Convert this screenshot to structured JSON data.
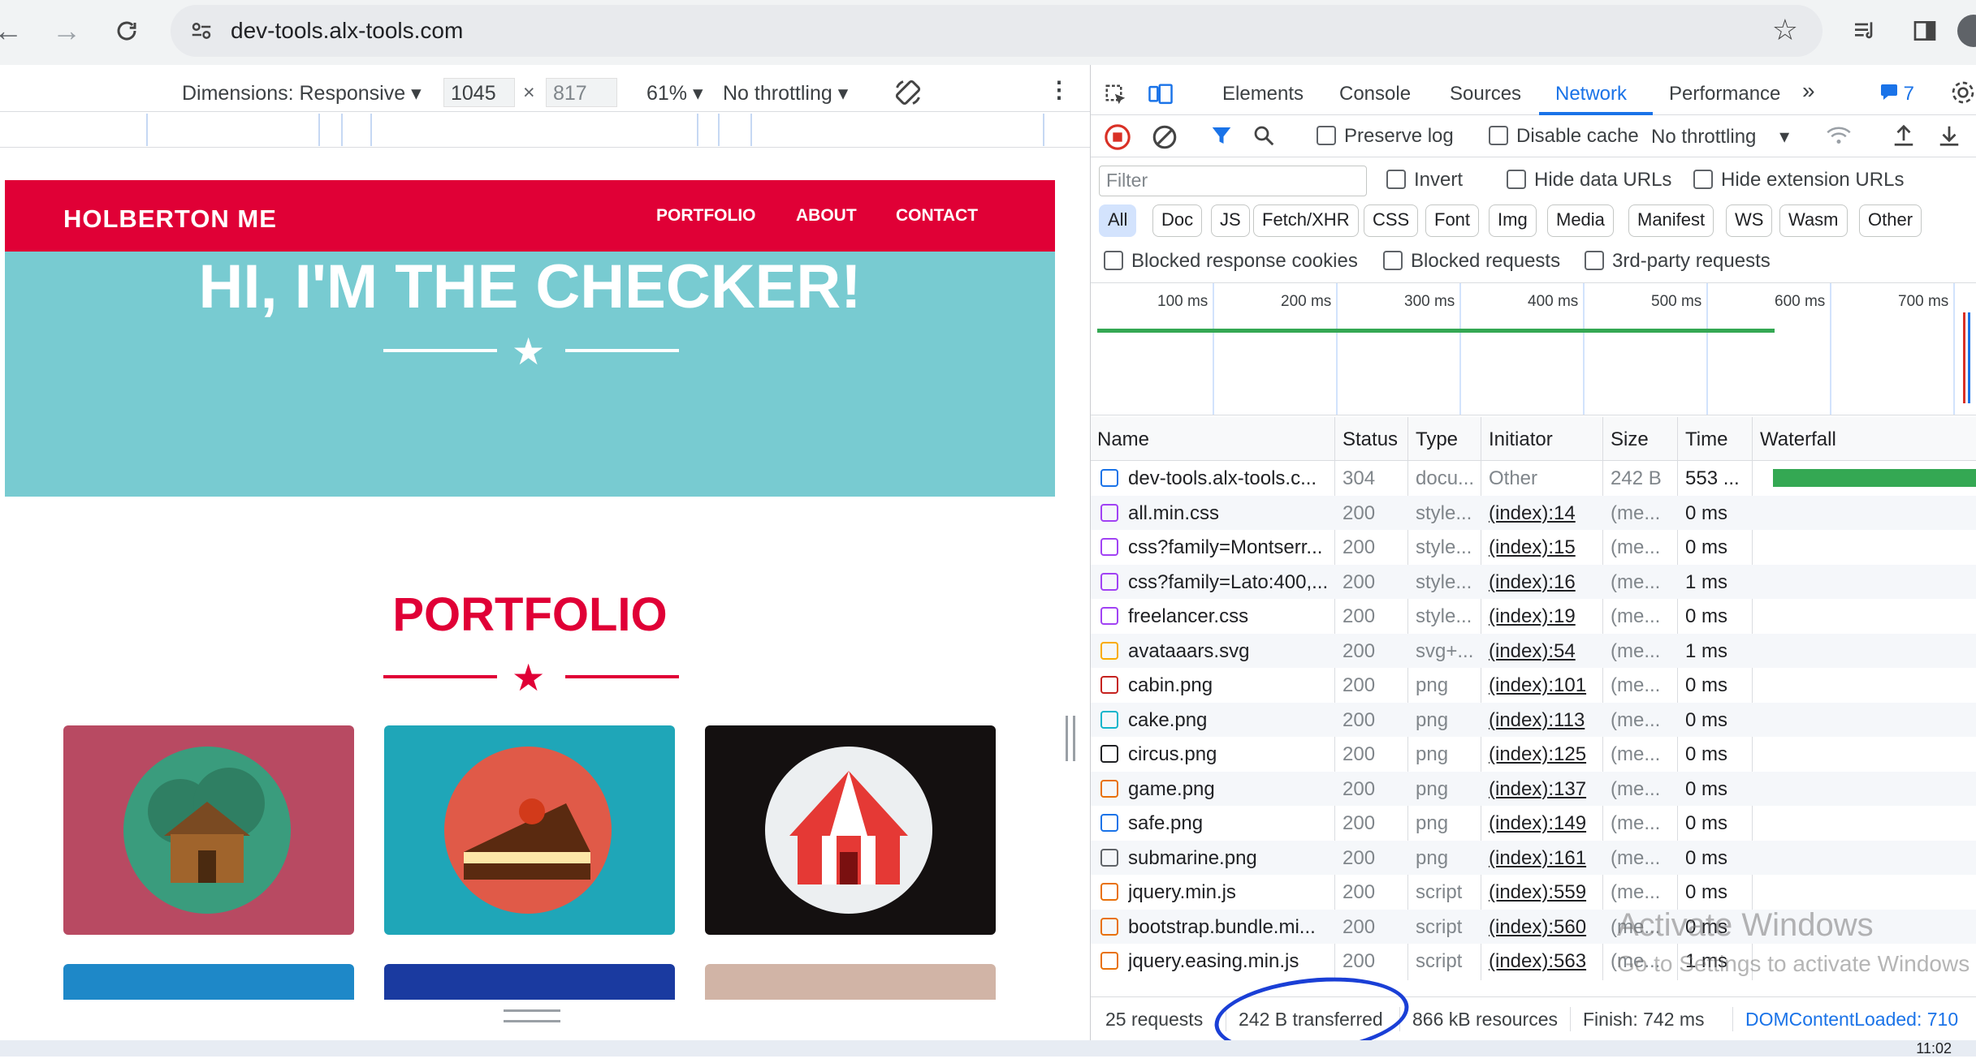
{
  "browser": {
    "url": "dev-tools.alx-tools.com"
  },
  "device_toolbar": {
    "dimensions_label": "Dimensions: Responsive",
    "width": "1045",
    "x_symbol": "×",
    "height": "817",
    "zoom": "61%",
    "throttling": "No throttling"
  },
  "page": {
    "brand": "HOLBERTON ME",
    "nav": [
      "PORTFOLIO",
      "ABOUT",
      "CONTACT"
    ],
    "hero_title": "HI, I'M THE CHECKER!",
    "portfolio_title": "PORTFOLIO",
    "colors": {
      "brand_red": "#e00036",
      "hero_teal": "#78cbd1"
    }
  },
  "devtools": {
    "tabs": [
      "Elements",
      "Console",
      "Sources",
      "Network",
      "Performance"
    ],
    "active_tab": "Network",
    "issues_count": "7",
    "toolbar": {
      "preserve_log": "Preserve log",
      "disable_cache": "Disable cache",
      "throttling": "No throttling"
    },
    "filter": {
      "placeholder": "Filter",
      "invert": "Invert",
      "hide_data_urls": "Hide data URLs",
      "hide_extension_urls": "Hide extension URLs"
    },
    "type_chips": [
      "All",
      "Doc",
      "JS",
      "Fetch/XHR",
      "CSS",
      "Font",
      "Img",
      "Media",
      "Manifest",
      "WS",
      "Wasm",
      "Other"
    ],
    "blocked": {
      "cookies": "Blocked response cookies",
      "requests": "Blocked requests",
      "third_party": "3rd-party requests"
    },
    "timeline_labels": [
      "100 ms",
      "200 ms",
      "300 ms",
      "400 ms",
      "500 ms",
      "600 ms",
      "700 ms"
    ],
    "columns": [
      "Name",
      "Status",
      "Type",
      "Initiator",
      "Size",
      "Time",
      "Waterfall"
    ],
    "rows": [
      {
        "name": "dev-tools.alx-tools.c...",
        "status": "304",
        "type": "docu...",
        "initiator": "Other",
        "size": "242 B",
        "time": "553 ..."
      },
      {
        "name": "all.min.css",
        "status": "200",
        "type": "style...",
        "initiator": "(index):14",
        "size": "(me...",
        "time": "0 ms"
      },
      {
        "name": "css?family=Montserr...",
        "status": "200",
        "type": "style...",
        "initiator": "(index):15",
        "size": "(me...",
        "time": "0 ms"
      },
      {
        "name": "css?family=Lato:400,...",
        "status": "200",
        "type": "style...",
        "initiator": "(index):16",
        "size": "(me...",
        "time": "1 ms"
      },
      {
        "name": "freelancer.css",
        "status": "200",
        "type": "style...",
        "initiator": "(index):19",
        "size": "(me...",
        "time": "0 ms"
      },
      {
        "name": "avataaars.svg",
        "status": "200",
        "type": "svg+...",
        "initiator": "(index):54",
        "size": "(me...",
        "time": "1 ms"
      },
      {
        "name": "cabin.png",
        "status": "200",
        "type": "png",
        "initiator": "(index):101",
        "size": "(me...",
        "time": "0 ms"
      },
      {
        "name": "cake.png",
        "status": "200",
        "type": "png",
        "initiator": "(index):113",
        "size": "(me...",
        "time": "0 ms"
      },
      {
        "name": "circus.png",
        "status": "200",
        "type": "png",
        "initiator": "(index):125",
        "size": "(me...",
        "time": "0 ms"
      },
      {
        "name": "game.png",
        "status": "200",
        "type": "png",
        "initiator": "(index):137",
        "size": "(me...",
        "time": "0 ms"
      },
      {
        "name": "safe.png",
        "status": "200",
        "type": "png",
        "initiator": "(index):149",
        "size": "(me...",
        "time": "0 ms"
      },
      {
        "name": "submarine.png",
        "status": "200",
        "type": "png",
        "initiator": "(index):161",
        "size": "(me...",
        "time": "0 ms"
      },
      {
        "name": "jquery.min.js",
        "status": "200",
        "type": "script",
        "initiator": "(index):559",
        "size": "(me...",
        "time": "0 ms"
      },
      {
        "name": "bootstrap.bundle.mi...",
        "status": "200",
        "type": "script",
        "initiator": "(index):560",
        "size": "(me...",
        "time": "0 ms"
      },
      {
        "name": "jquery.easing.min.js",
        "status": "200",
        "type": "script",
        "initiator": "(index):563",
        "size": "(me...",
        "time": "1 ms"
      }
    ],
    "status_bar": {
      "requests": "25 requests",
      "transferred": "242 B transferred",
      "resources": "866 kB resources",
      "finish": "Finish: 742 ms",
      "dcl": "DOMContentLoaded: 710"
    },
    "watermark": "Activate Windows",
    "watermark_sub": "Go to Settings to activate Windows"
  },
  "taskbar": {
    "clock": "11:02"
  }
}
